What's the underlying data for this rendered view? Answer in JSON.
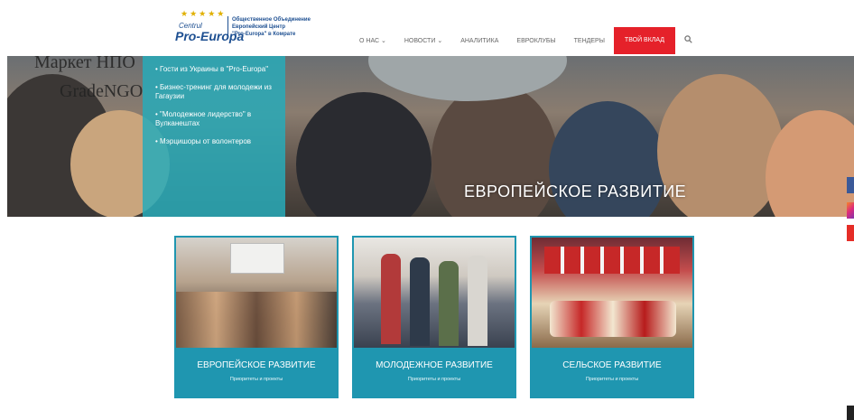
{
  "header": {
    "logo": {
      "small_text": "Centrul",
      "main_text": "Pro-Europa",
      "subtitle_lines": [
        "Общественное Объединение",
        "Европейский Центр",
        "\"Pro-Europa\" в Комрате"
      ]
    },
    "nav": {
      "items": [
        "О НАС",
        "НОВОСТИ",
        "АНАЛИТИКА",
        "ЕВРОКЛУБЫ",
        "ТЕНДЕРЫ"
      ],
      "cta_label": "ТВОЙ ВКЛАД"
    }
  },
  "hero": {
    "bg_text_line1": "Маркет НПО",
    "bg_text_line2": "GradeNGO",
    "news": [
      "Гости из Украины в \"Pro-Europa\"",
      "Бизнес-тренинг для молодежи из Гагаузии",
      "\"Молодежное лидерство\" в Вулканештах",
      "Мэрцишоры от волонтеров"
    ],
    "caption": "ЕВРОПЕЙСКОЕ РАЗВИТИЕ"
  },
  "cards": [
    {
      "title": "ЕВРОПЕЙСКОЕ РАЗВИТИЕ",
      "subtitle": "Приоритеты и проекты"
    },
    {
      "title": "МОЛОДЕЖНОЕ РАЗВИТИЕ",
      "subtitle": "Приоритеты и проекты"
    },
    {
      "title": "СЕЛЬСКОЕ РАЗВИТИЕ",
      "subtitle": "Приоритеты и проекты"
    }
  ],
  "colors": {
    "accent_teal": "#1f96b0",
    "cta_red": "#e5212a",
    "brand_blue": "#1d4f91"
  },
  "icons": [
    "search-icon",
    "facebook-icon",
    "instagram-icon",
    "youtube-icon"
  ]
}
